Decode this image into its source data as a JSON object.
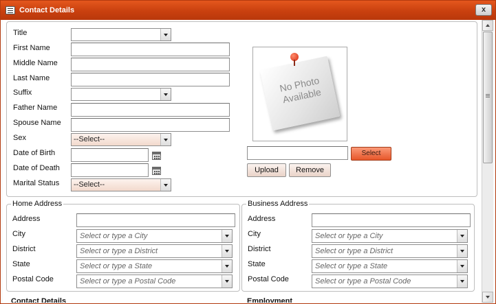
{
  "window": {
    "title": "Contact Details",
    "close_label": "x"
  },
  "personal": {
    "title_label": "Title",
    "first_name_label": "First Name",
    "middle_name_label": "Middle Name",
    "last_name_label": "Last Name",
    "suffix_label": "Suffix",
    "father_name_label": "Father Name",
    "spouse_name_label": "Spouse Name",
    "sex_label": "Sex",
    "sex_value": "--Select--",
    "dob_label": "Date of Birth",
    "dod_label": "Date of Death",
    "marital_label": "Marital Status",
    "marital_value": "--Select--"
  },
  "photo": {
    "placeholder_line1": "No Photo",
    "placeholder_line2": "Available",
    "select_label": "Select",
    "upload_label": "Upload",
    "remove_label": "Remove"
  },
  "home_address": {
    "legend": "Home Address",
    "address_label": "Address",
    "city_label": "City",
    "city_placeholder": "Select or type a City",
    "district_label": "District",
    "district_placeholder": "Select or type a District",
    "state_label": "State",
    "state_placeholder": "Select or type a State",
    "postal_label": "Postal Code",
    "postal_placeholder": "Select or type a Postal Code"
  },
  "business_address": {
    "legend": "Business Address",
    "address_label": "Address",
    "city_label": "City",
    "city_placeholder": "Select or type a City",
    "district_label": "District",
    "district_placeholder": "Select or type a District",
    "state_label": "State",
    "state_placeholder": "Select or type a State",
    "postal_label": "Postal Code",
    "postal_placeholder": "Select or type a Postal Code"
  },
  "next_sections": {
    "contact_details": "Contact Details",
    "employment": "Employment"
  }
}
